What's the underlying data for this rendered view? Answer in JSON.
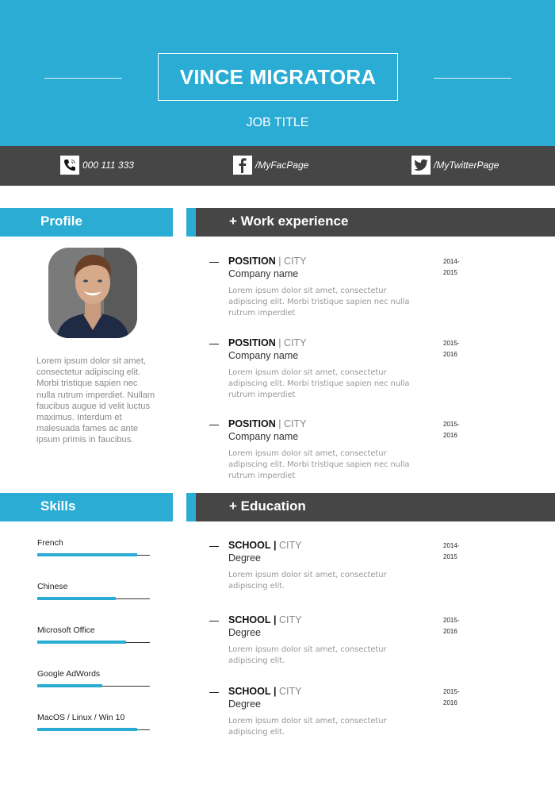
{
  "header": {
    "name": "VINCE MIGRATORA",
    "job_title": "JOB TITLE",
    "accent_color": "#2aacd5",
    "dark_color": "#464646"
  },
  "contacts": [
    {
      "icon": "phone-icon",
      "text": "000 111 333"
    },
    {
      "icon": "facebook-icon",
      "text": "/MyFacPage"
    },
    {
      "icon": "twitter-icon",
      "text": "/MyTwitterPage"
    }
  ],
  "profile": {
    "heading": "Profile",
    "photo": "profile-photo",
    "text": "Lorem ipsum dolor sit amet, consectetur adipiscing elit. Morbi tristique sapien nec nulla rutrum imperdiet. Nullam faucibus augue id velit luctus maximus. Interdum et malesuada fames ac ante ipsum primis in faucibus."
  },
  "work": {
    "heading": "+ Work experience",
    "items": [
      {
        "position": "POSITION",
        "sep": "|",
        "city": "CITY",
        "company": "Company name",
        "desc": "Lorem ipsum dolor sit amet, consectetur adipiscing elit. Morbi tristique sapien nec nulla rutrum imperdiet",
        "date_start": "2014-",
        "date_end": "2015"
      },
      {
        "position": "POSITION",
        "sep": "|",
        "city": "CITY",
        "company": "Company name",
        "desc": "Lorem ipsum dolor sit amet, consectetur adipiscing elit. Morbi tristique sapien nec nulla rutrum imperdiet",
        "date_start": "2015-",
        "date_end": "2016"
      },
      {
        "position": "POSITION",
        "sep": "|",
        "city": "CITY",
        "company": "Company name",
        "desc": "Lorem ipsum dolor sit amet, consectetur adipiscing elit. Morbi tristique sapien nec nulla rutrum imperdiet",
        "date_start": "2015-",
        "date_end": "2016"
      }
    ]
  },
  "skills": {
    "heading": "Skills",
    "items": [
      {
        "label": "French",
        "level": 0.89
      },
      {
        "label": "Chinese",
        "level": 0.7
      },
      {
        "label": "Microsoft Office",
        "level": 0.79
      },
      {
        "label": "Google AdWords",
        "level": 0.58
      },
      {
        "label": "MacOS / Linux / Win 10",
        "level": 0.89
      }
    ]
  },
  "education": {
    "heading": "+ Education",
    "items": [
      {
        "school": "SCHOOL",
        "sep": "|",
        "city": "CITY",
        "degree": "Degree",
        "desc": "Lorem ipsum dolor sit amet, consectetur adipiscing elit.",
        "date_start": "2014-",
        "date_end": "2015"
      },
      {
        "school": "SCHOOL",
        "sep": "|",
        "city": "CITY",
        "degree": "Degree",
        "desc": "Lorem ipsum dolor sit amet, consectetur adipiscing elit.",
        "date_start": "2015-",
        "date_end": "2016"
      },
      {
        "school": "SCHOOL",
        "sep": "|",
        "city": "CITY",
        "degree": "Degree",
        "desc": "Lorem ipsum dolor sit amet, consectetur adipiscing elit.",
        "date_start": "2015-",
        "date_end": "2016"
      }
    ]
  }
}
